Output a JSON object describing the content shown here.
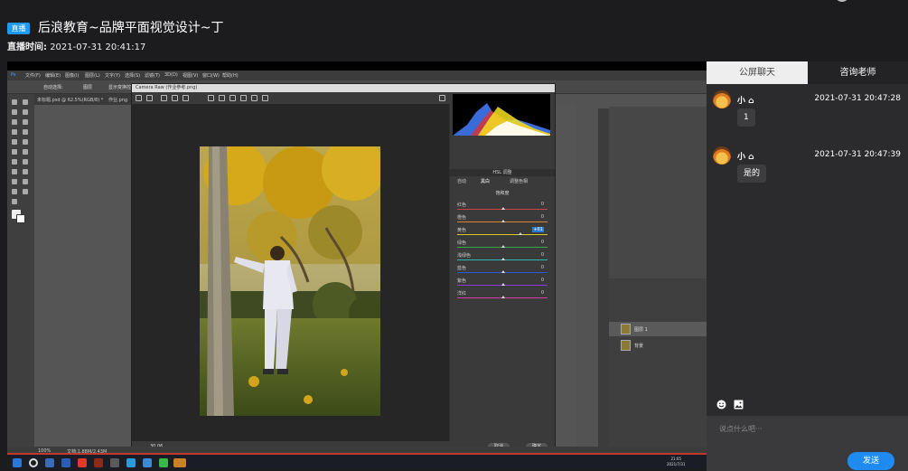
{
  "header": {
    "badge": "直播",
    "title": "后浪教育~品牌平面视觉设计~丁",
    "time_label": "直播时间:",
    "time_value": "2021-07-31 20:41:17"
  },
  "video": {
    "ps_menu": [
      "文件(F)",
      "编辑(E)",
      "图像(I)",
      "图层(L)",
      "文字(Y)",
      "选择(S)",
      "滤镜(T)",
      "3D(D)",
      "视图(V)",
      "窗口(W)",
      "帮助(H)"
    ],
    "ps_options": [
      "自动选择:",
      "图层",
      "显示变换控件"
    ],
    "ps_tabs": [
      "未标题.psd @ 62.5%(RGB/8) *",
      "作业.png"
    ],
    "camera_raw": {
      "title": "Camera Raw (作业参考.png)",
      "zoom": "30.06",
      "tabs": [
        "自动",
        "黑白",
        "调整色相"
      ],
      "panel_title": "HSL 调整",
      "section": "饱和度",
      "sliders": [
        {
          "label": "红色",
          "value": "0"
        },
        {
          "label": "橙色",
          "value": "0"
        },
        {
          "label": "黄色",
          "value": "+61"
        },
        {
          "label": "绿色",
          "value": "0"
        },
        {
          "label": "浅绿色",
          "value": "0"
        },
        {
          "label": "蓝色",
          "value": "0"
        },
        {
          "label": "紫色",
          "value": "0"
        },
        {
          "label": "洋红",
          "value": "0"
        }
      ],
      "cancel": "取消",
      "ok": "确定"
    },
    "layers": [
      "图层 1",
      "背景"
    ],
    "status": [
      "100%",
      "文档:1.88M/2.43M"
    ],
    "clock_time": "21:05",
    "clock_date": "2021/7/31"
  },
  "chat": {
    "tab_public": "公屏聊天",
    "tab_consult": "咨询老师",
    "messages": [
      {
        "name": "小",
        "time": "2021-07-31 20:47:28",
        "text": "1"
      },
      {
        "name": "小",
        "time": "2021-07-31 20:47:39",
        "text": "是的"
      }
    ],
    "input_placeholder": "说点什么吧···",
    "send": "发送"
  },
  "colors": {
    "accent": "#1f8bf0",
    "badge": "#1e9af0",
    "background": "#1c1c1f",
    "chat_bg": "#2b2b2e"
  }
}
